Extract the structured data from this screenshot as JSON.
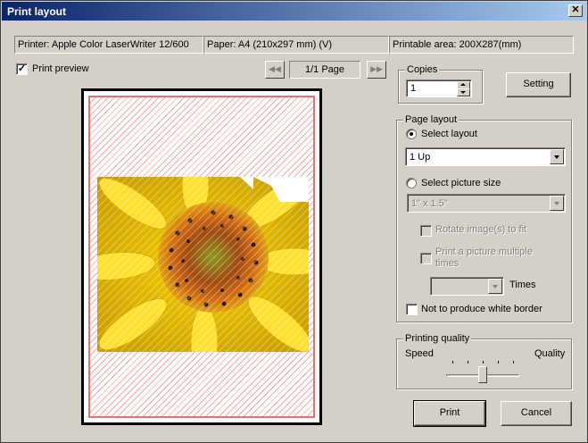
{
  "window": {
    "title": "Print layout",
    "close_glyph": "✕"
  },
  "info": {
    "printer": "Printer: Apple Color LaserWriter 12/600",
    "paper": "Paper: A4 (210x297 mm) (V)",
    "printable": "Printable area: 200X287(mm)"
  },
  "preview": {
    "checkbox_label": "Print preview",
    "checked": true,
    "page_indicator": "1/1 Page"
  },
  "copies": {
    "group_title": "Copies",
    "value": "1"
  },
  "setting_label": "Setting",
  "page_layout": {
    "group_title": "Page layout",
    "select_layout_label": "Select layout",
    "layout_value": "1 Up",
    "select_picture_size_label": "Select picture size",
    "picture_size_value": "1\" x 1.5\"",
    "rotate_label": "Rotate image(s) to fit",
    "multiple_label_line1": "Print a picture multiple",
    "multiple_label_line2": "times",
    "times_label": "Times",
    "no_border_label": "Not to produce white border"
  },
  "printing_quality": {
    "group_title": "Printing quality",
    "speed_label": "Speed",
    "quality_label": "Quality",
    "level": 0.5
  },
  "print_label": "Print",
  "cancel_label": "Cancel",
  "colors": {
    "title_bar_start": "#0a246a",
    "title_bar_end": "#a6caf0",
    "preview_frame": "#e87070"
  }
}
